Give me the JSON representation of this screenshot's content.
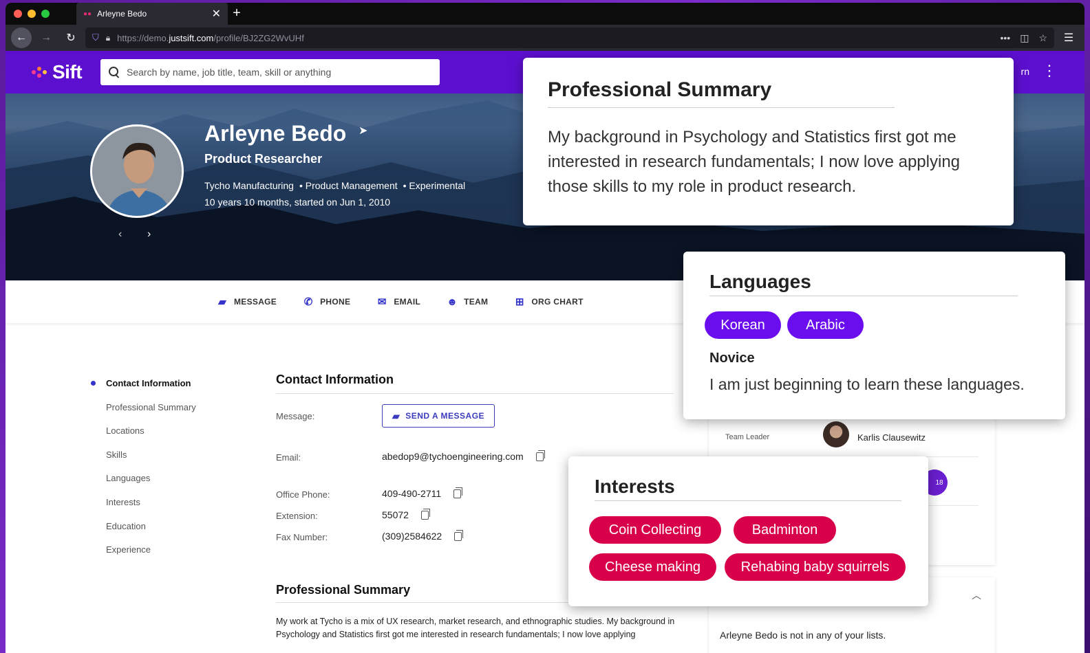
{
  "browser": {
    "tab_title": "Arleyne Bedo",
    "url_prefix": "https://demo.",
    "url_host": "justsift.com",
    "url_path": "/profile/BJ2ZG2WvUHf"
  },
  "header": {
    "logo_text": "Sift",
    "search_placeholder": "Search by name, job title, team, skill or anything",
    "right_partial_text": "rn"
  },
  "profile": {
    "name": "Arleyne Bedo",
    "title": "Product Researcher",
    "company": "Tycho Manufacturing",
    "department": "• Product Management",
    "group": "• Experimental",
    "tenure": "10 years 10 months, started on Jun 1, 2010"
  },
  "actions": [
    {
      "label": "MESSAGE",
      "icon": "message-icon"
    },
    {
      "label": "PHONE",
      "icon": "phone-icon"
    },
    {
      "label": "EMAIL",
      "icon": "email-icon"
    },
    {
      "label": "TEAM",
      "icon": "team-icon"
    },
    {
      "label": "ORG CHART",
      "icon": "org-chart-icon"
    }
  ],
  "sidenav": [
    "Contact Information",
    "Professional Summary",
    "Locations",
    "Skills",
    "Languages",
    "Interests",
    "Education",
    "Experience"
  ],
  "contact": {
    "title": "Contact Information",
    "message_label": "Message:",
    "send_label": "SEND A MESSAGE",
    "email_label": "Email:",
    "email": "abedop9@tychoengineering.com",
    "office_label": "Office Phone:",
    "office": "409-490-2711",
    "ext_label": "Extension:",
    "ext": "55072",
    "fax_label": "Fax Number:",
    "fax": "(309)2584622"
  },
  "summary_section": {
    "title": "Professional Summary",
    "text": "My work at Tycho is a mix of UX research, market research, and ethnographic studies. My background in Psychology and Statistics first got me interested in research fundamentals; I now love applying"
  },
  "team": {
    "leader_label": "Team Leader",
    "leader_name": "Karlis Clausewitz",
    "count": "18"
  },
  "lists_text": "Arleyne Bedo is not in any of your lists.",
  "popup_summary": {
    "title": "Professional Summary",
    "text": "My background in Psychology and Statistics first got me interested in research fundamentals; I now love applying those skills to my role in product research."
  },
  "popup_languages": {
    "title": "Languages",
    "chips": [
      "Korean",
      "Arabic"
    ],
    "level": "Novice",
    "description": "I am just beginning to learn these languages.",
    "chip_color": "#6a0ef0"
  },
  "popup_interests": {
    "title": "Interests",
    "chips": [
      "Coin Collecting",
      "Badminton",
      "Cheese making",
      "Rehabing baby squirrels"
    ],
    "chip_color": "#d8004a"
  }
}
